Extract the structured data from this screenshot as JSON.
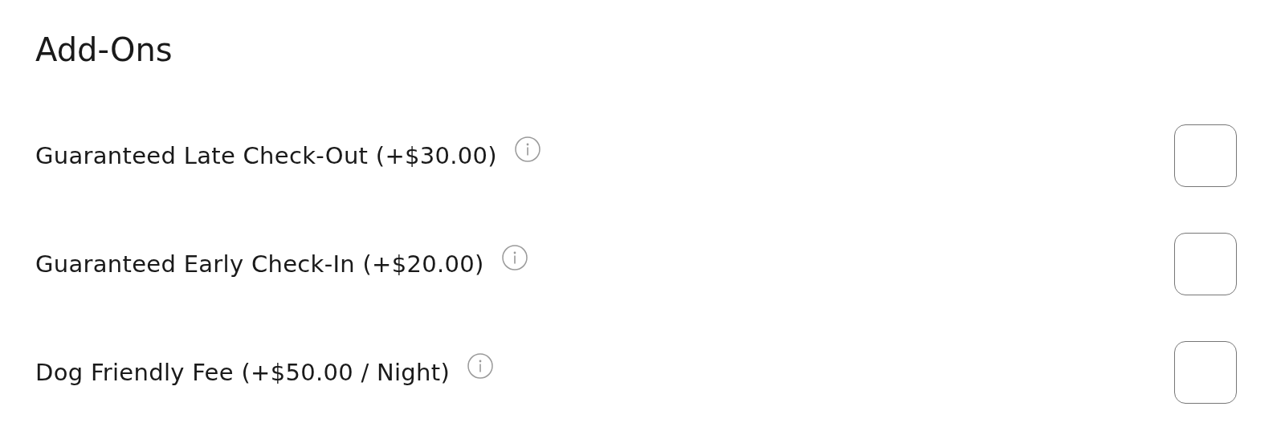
{
  "title": "Add-Ons",
  "addons": [
    {
      "label": "Guaranteed Late Check-Out (+$30.00)",
      "checked": false
    },
    {
      "label": "Guaranteed Early Check-In (+$20.00)",
      "checked": false
    },
    {
      "label": "Dog Friendly Fee (+$50.00 / Night)",
      "checked": false
    }
  ]
}
